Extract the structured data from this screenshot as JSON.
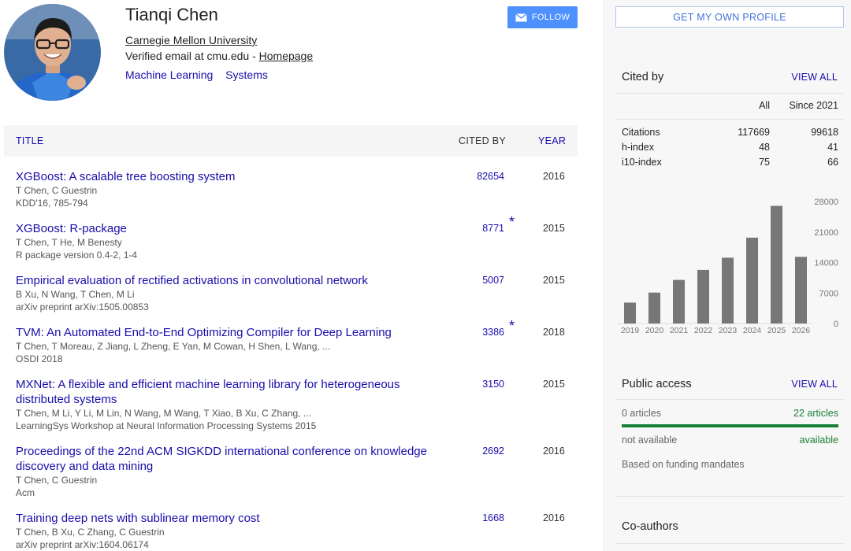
{
  "profile": {
    "name": "Tianqi Chen",
    "affiliation": "Carnegie Mellon University",
    "email_text": "Verified email at cmu.edu - ",
    "homepage_label": "Homepage",
    "interests": [
      "Machine Learning",
      "Systems"
    ],
    "follow_label": "FOLLOW"
  },
  "table": {
    "header": {
      "title": "TITLE",
      "cited_by": "CITED BY",
      "year": "YEAR"
    },
    "rows": [
      {
        "title": "XGBoost: A scalable tree boosting system",
        "authors": "T Chen, C Guestrin",
        "venue": "KDD'16, 785-794",
        "cited_by": "82654",
        "star": "",
        "year": "2016"
      },
      {
        "title": "XGBoost: R-package",
        "authors": "T Chen, T He, M Benesty",
        "venue": "R package version 0.4-2, 1-4",
        "cited_by": "8771",
        "star": "*",
        "year": "2015"
      },
      {
        "title": "Empirical evaluation of rectified activations in convolutional network",
        "authors": "B Xu, N Wang, T Chen, M Li",
        "venue": "arXiv preprint arXiv:1505.00853",
        "cited_by": "5007",
        "star": "",
        "year": "2015"
      },
      {
        "title": "TVM: An Automated End-to-End Optimizing Compiler for Deep Learning",
        "authors": "T Chen, T Moreau, Z Jiang, L Zheng, E Yan, M Cowan, H Shen, L Wang, ...",
        "venue": "OSDI 2018",
        "cited_by": "3386",
        "star": "*",
        "year": "2018"
      },
      {
        "title": "MXNet: A flexible and efficient machine learning library for heterogeneous distributed systems",
        "authors": "T Chen, M Li, Y Li, M Lin, N Wang, M Wang, T Xiao, B Xu, C Zhang, ...",
        "venue": "LearningSys Workshop at Neural Information Processing Systems 2015",
        "cited_by": "3150",
        "star": "",
        "year": "2015"
      },
      {
        "title": "Proceedings of the 22nd ACM SIGKDD international conference on knowledge discovery and data mining",
        "authors": "T Chen, C Guestrin",
        "venue": "Acm",
        "cited_by": "2692",
        "star": "",
        "year": "2016"
      },
      {
        "title": "Training deep nets with sublinear memory cost",
        "authors": "T Chen, B Xu, C Zhang, C Guestrin",
        "venue": "arXiv preprint arXiv:1604.06174",
        "cited_by": "1668",
        "star": "",
        "year": "2016"
      }
    ]
  },
  "sidebar": {
    "own_profile_label": "GET MY OWN PROFILE",
    "cited_by": {
      "heading": "Cited by",
      "view_all": "VIEW ALL",
      "col_all": "All",
      "col_since": "Since 2021",
      "stats": [
        {
          "label": "Citations",
          "all": "117669",
          "since": "99618"
        },
        {
          "label": "h-index",
          "all": "48",
          "since": "41"
        },
        {
          "label": "i10-index",
          "all": "75",
          "since": "66"
        }
      ]
    },
    "public_access": {
      "heading": "Public access",
      "view_all": "VIEW ALL",
      "not_available_count": "0 articles",
      "available_count": "22 articles",
      "not_available_label": "not available",
      "available_label": "available",
      "mandates": "Based on funding mandates"
    },
    "coauthors_heading": "Co-authors"
  },
  "colors": {
    "link": "#1a0dab",
    "accent_blue": "#4d90fe",
    "green": "#188038",
    "bar": "#777777"
  },
  "chart_data": {
    "type": "bar",
    "categories": [
      "2019",
      "2020",
      "2021",
      "2022",
      "2023",
      "2024",
      "2025",
      "2026"
    ],
    "values": [
      4800,
      7100,
      10000,
      12300,
      15100,
      19700,
      27000,
      15300
    ],
    "yticks": [
      0,
      7000,
      14000,
      21000,
      28000
    ],
    "ylim": [
      0,
      28000
    ],
    "title": "",
    "xlabel": "",
    "ylabel": ""
  }
}
